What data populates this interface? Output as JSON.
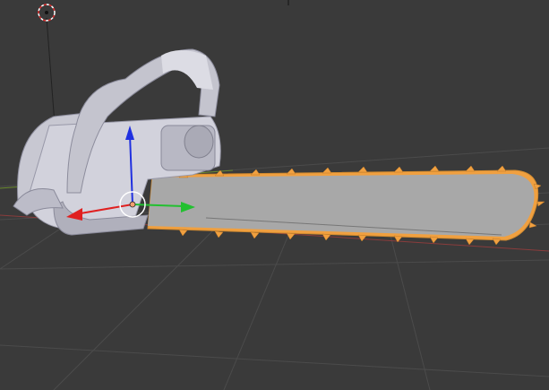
{
  "window": {
    "title": ""
  },
  "viewport": {
    "mode": "3D View",
    "background_color": "#3a3a3a",
    "grid_color": "#4b4b4b",
    "x_axis_color": "#8a3c3c",
    "y_axis_color": "#6a8a2e"
  },
  "scene": {
    "object": "chainsaw",
    "selected_part": "chain",
    "selection_outline_color": "#f0a040",
    "body_color": "#c8c8d2",
    "bar_color": "#a8a8a8"
  },
  "gizmo": {
    "x_color": "#e02020",
    "y_color": "#22c030",
    "z_color": "#2030e0",
    "pivot_color": "#f4a070"
  },
  "icons": [
    "3d-cursor-icon",
    "transform-gizmo-icon"
  ]
}
